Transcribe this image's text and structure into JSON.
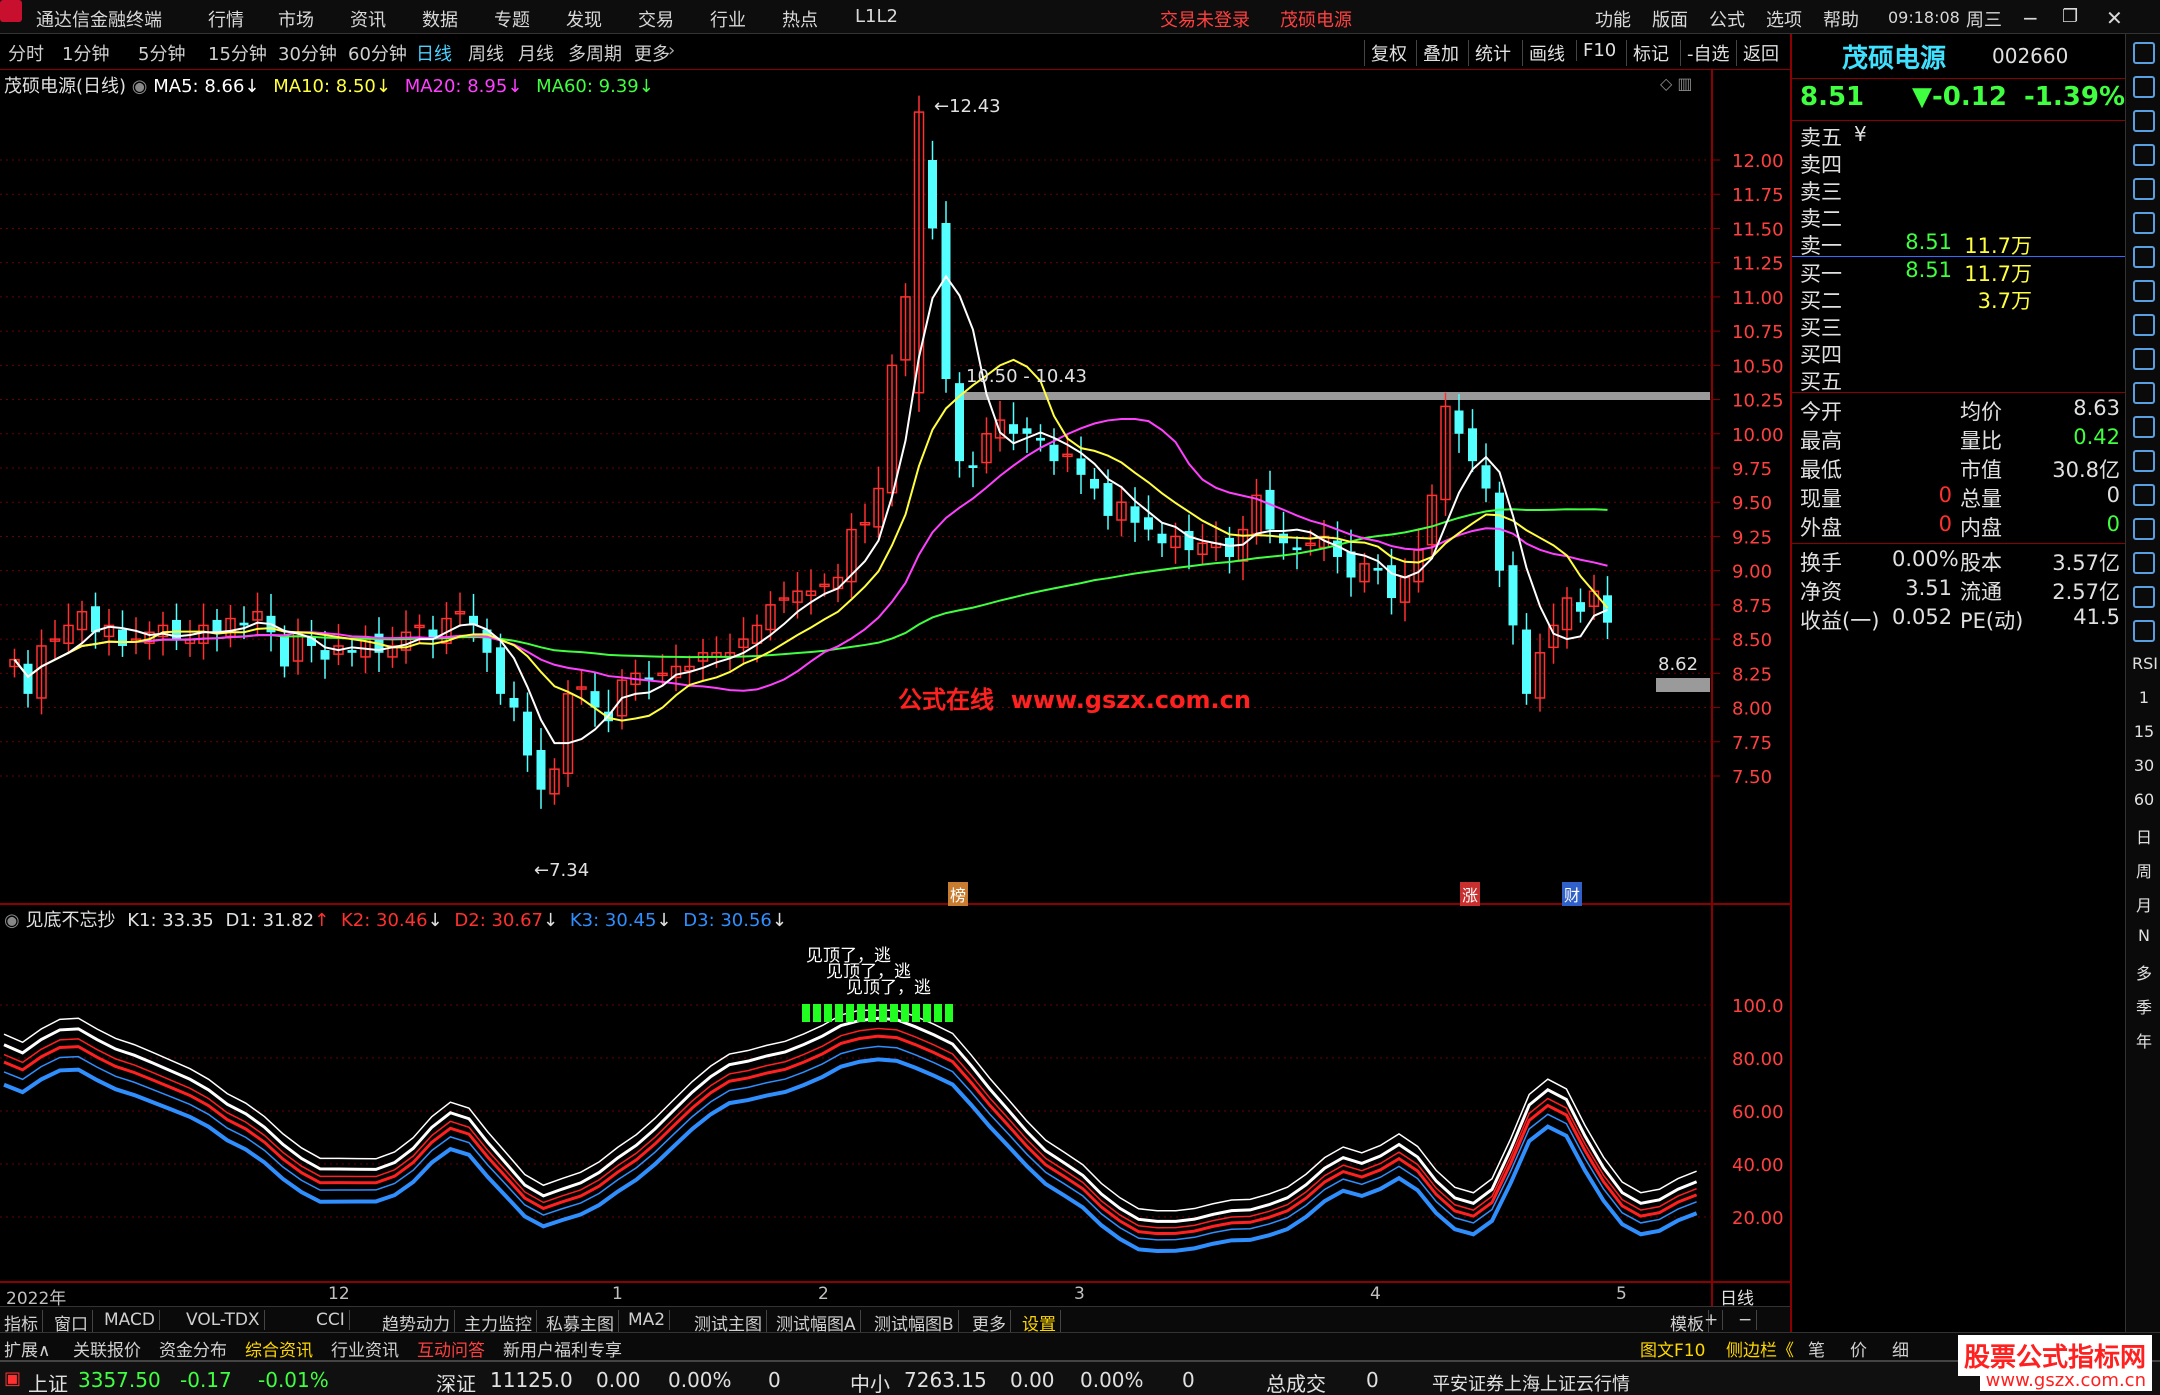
{
  "menubar": {
    "app_title": "通达信金融终端",
    "items": [
      "行情",
      "市场",
      "资讯",
      "数据",
      "专题",
      "发现",
      "交易",
      "行业",
      "热点",
      "L1L2"
    ],
    "login": "交易未登录",
    "stock": "茂硕电源",
    "right_items": [
      "功能",
      "版面",
      "公式",
      "选项",
      "帮助"
    ],
    "time": "09:18:08",
    "weekday": "周三"
  },
  "periods": [
    "分时",
    "1分钟",
    "5分钟",
    "15分钟",
    "30分钟",
    "60分钟",
    "日线",
    "周线",
    "月线",
    "多周期",
    "更多"
  ],
  "active_period": "日线",
  "chart_tools": [
    "复权",
    "叠加",
    "统计",
    "画线",
    "F10",
    "标记",
    "-自选",
    "返回"
  ],
  "main_header": {
    "name": "茂硕电源(日线)",
    "ma5": "MA5: 8.66",
    "ma10": "MA10: 8.50",
    "ma20": "MA20: 8.95",
    "ma60": "MA60: 9.39",
    "arrow": "↓"
  },
  "price_axis": [
    "12.00",
    "11.75",
    "11.50",
    "11.25",
    "11.00",
    "10.75",
    "10.50",
    "10.25",
    "10.00",
    "9.75",
    "9.50",
    "9.25",
    "9.00",
    "8.75",
    "8.50",
    "8.25",
    "8.00",
    "7.75",
    "7.50"
  ],
  "annotations": {
    "high": "12.43",
    "low": "7.34",
    "band": "10.50 - 10.43",
    "current": "8.62",
    "watermark": "公式在线  www.gszx.com.cn",
    "mark1": "榜",
    "mark2": "涨",
    "mark3": "财"
  },
  "sub_header": {
    "name": "见底不忘抄",
    "k1": "K1: 33.35",
    "d1": "D1: 31.82",
    "k2": "K2: 30.46",
    "d2": "D2: 30.67",
    "k3": "K3: 30.45",
    "d3": "D3: 30.56"
  },
  "sub_axis": [
    "100.0",
    "80.00",
    "60.00",
    "40.00",
    "20.00"
  ],
  "sub_text": "见顶了，逃",
  "date_axis": [
    "2022年",
    "12",
    "1",
    "2",
    "3",
    "4",
    "5"
  ],
  "date_axis_right": "日线",
  "quote": {
    "name": "茂硕电源",
    "code": "002660",
    "price": "8.51",
    "change": "▼-0.12",
    "pct": "-1.39%",
    "asks": [
      {
        "label": "卖五",
        "p": "",
        "v": ""
      },
      {
        "label": "卖四",
        "p": "",
        "v": ""
      },
      {
        "label": "卖三",
        "p": "",
        "v": ""
      },
      {
        "label": "卖二",
        "p": "",
        "v": ""
      },
      {
        "label": "卖一",
        "p": "8.51",
        "v": "11.7万"
      }
    ],
    "bids": [
      {
        "label": "买一",
        "p": "8.51",
        "v": "11.7万"
      },
      {
        "label": "买二",
        "p": "",
        "v": "3.7万"
      },
      {
        "label": "买三",
        "p": "",
        "v": ""
      },
      {
        "label": "买四",
        "p": "",
        "v": ""
      },
      {
        "label": "买五",
        "p": "",
        "v": ""
      }
    ],
    "yen": "¥",
    "stats": [
      [
        "今开",
        "",
        "均价",
        "8.63"
      ],
      [
        "最高",
        "",
        "量比",
        "0.42"
      ],
      [
        "最低",
        "",
        "市值",
        "30.8亿"
      ],
      [
        "现量",
        "0",
        "总量",
        "0"
      ],
      [
        "外盘",
        "0",
        "内盘",
        "0"
      ],
      [
        "换手",
        "0.00%",
        "股本",
        "3.57亿"
      ],
      [
        "净资",
        "3.51",
        "流通",
        "2.57亿"
      ],
      [
        "收益(一)",
        "0.052",
        "PE(动)",
        "41.5"
      ]
    ]
  },
  "sidebar_labels": [
    "RSI",
    "1",
    "15",
    "30",
    "60",
    "日",
    "周",
    "月",
    "N",
    "多",
    "季",
    "年"
  ],
  "bottom_tabs": [
    "指标",
    "窗口",
    "MACD",
    "VOL-TDX",
    "CCI",
    "趋势动力",
    "主力监控",
    "私募主图",
    "MA2",
    "测试主图",
    "测试幅图A",
    "测试幅图B",
    "更多",
    "设置",
    "模板",
    "+",
    "−"
  ],
  "bottom_tabs2": [
    "扩展∧",
    "关联报价",
    "资金分布",
    "综合资讯",
    "行业资讯",
    "互动问答",
    "新用户福利专享"
  ],
  "bottom_right": [
    "图文F10",
    "侧边栏《",
    "笔",
    "价",
    "细"
  ],
  "status": {
    "sh_label": "上证",
    "sh": "3357.50",
    "sh_chg": "-0.17",
    "sh_pct": "-0.01%",
    "sz_label": "深证",
    "sz": "11125.0",
    "sz_chg": "0.00",
    "sz_pct": "0.00%",
    "sz_vol": "0",
    "zx_label": "中小",
    "zx": "7263.15",
    "zx_chg": "0.00",
    "zx_pct": "0.00%",
    "zx_vol": "0",
    "total_label": "总成交",
    "total": "0",
    "broker": "平安证券上海上证云行情"
  },
  "site_badge": "股票公式指标网",
  "site_url": "www.gszx.com.cn",
  "colors": {
    "up": "#ff3030",
    "down": "#54ffff",
    "ma5": "#ffffff",
    "ma10": "#ffff40",
    "ma20": "#ff40ff",
    "ma60": "#40ff40",
    "grid": "#6b0000"
  },
  "chart_data": {
    "type": "candlestick",
    "title": "茂硕电源(日线)",
    "ylim": [
      7.2,
      12.6
    ],
    "candles": []
  }
}
